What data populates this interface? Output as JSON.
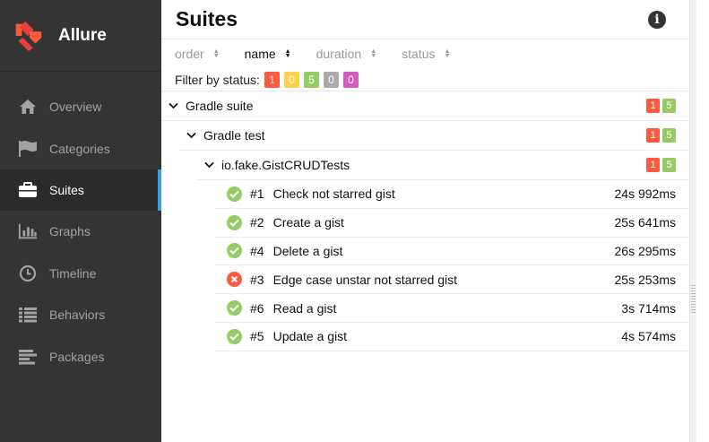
{
  "brand": {
    "name": "Allure"
  },
  "nav": [
    {
      "key": "overview",
      "label": "Overview",
      "icon": "home-icon",
      "active": false
    },
    {
      "key": "categories",
      "label": "Categories",
      "icon": "flag-icon",
      "active": false
    },
    {
      "key": "suites",
      "label": "Suites",
      "icon": "briefcase-icon",
      "active": true
    },
    {
      "key": "graphs",
      "label": "Graphs",
      "icon": "bar-chart-icon",
      "active": false
    },
    {
      "key": "timeline",
      "label": "Timeline",
      "icon": "clock-icon",
      "active": false
    },
    {
      "key": "behaviors",
      "label": "Behaviors",
      "icon": "list-icon",
      "active": false
    },
    {
      "key": "packages",
      "label": "Packages",
      "icon": "align-left-icon",
      "active": false
    }
  ],
  "pane": {
    "title": "Suites"
  },
  "sort": {
    "order": "order",
    "name": "name",
    "duration": "duration",
    "status": "status",
    "active": "name"
  },
  "filter": {
    "label": "Filter by status:",
    "counts": [
      {
        "status": "failed",
        "value": "1",
        "color": "#fd5a3e"
      },
      {
        "status": "broken",
        "value": "0",
        "color": "#ffd050"
      },
      {
        "status": "passed",
        "value": "5",
        "color": "#97cc64"
      },
      {
        "status": "skipped",
        "value": "0",
        "color": "#aaaaaa"
      },
      {
        "status": "unknown",
        "value": "0",
        "color": "#d35ebe"
      }
    ]
  },
  "tree": {
    "suite": {
      "name": "Gradle suite",
      "failed": "1",
      "passed": "5"
    },
    "test": {
      "name": "Gradle test",
      "failed": "1",
      "passed": "5"
    },
    "klass": {
      "name": "io.fake.GistCRUDTests",
      "failed": "1",
      "passed": "5"
    },
    "cases": [
      {
        "num": "#1",
        "name": "Check not starred gist",
        "duration": "24s 992ms",
        "status": "passed"
      },
      {
        "num": "#2",
        "name": "Create a gist",
        "duration": "25s 641ms",
        "status": "passed"
      },
      {
        "num": "#4",
        "name": "Delete a gist",
        "duration": "26s 295ms",
        "status": "passed"
      },
      {
        "num": "#3",
        "name": "Edge case unstar not starred gist",
        "duration": "25s 253ms",
        "status": "failed"
      },
      {
        "num": "#6",
        "name": "Read a gist",
        "duration": "3s 714ms",
        "status": "passed"
      },
      {
        "num": "#5",
        "name": "Update a gist",
        "duration": "4s 574ms",
        "status": "passed"
      }
    ]
  },
  "colors": {
    "failed": "#fd5a3e",
    "passed": "#97cc64",
    "accent": "#39a0e5",
    "sidebar": "#343434"
  }
}
